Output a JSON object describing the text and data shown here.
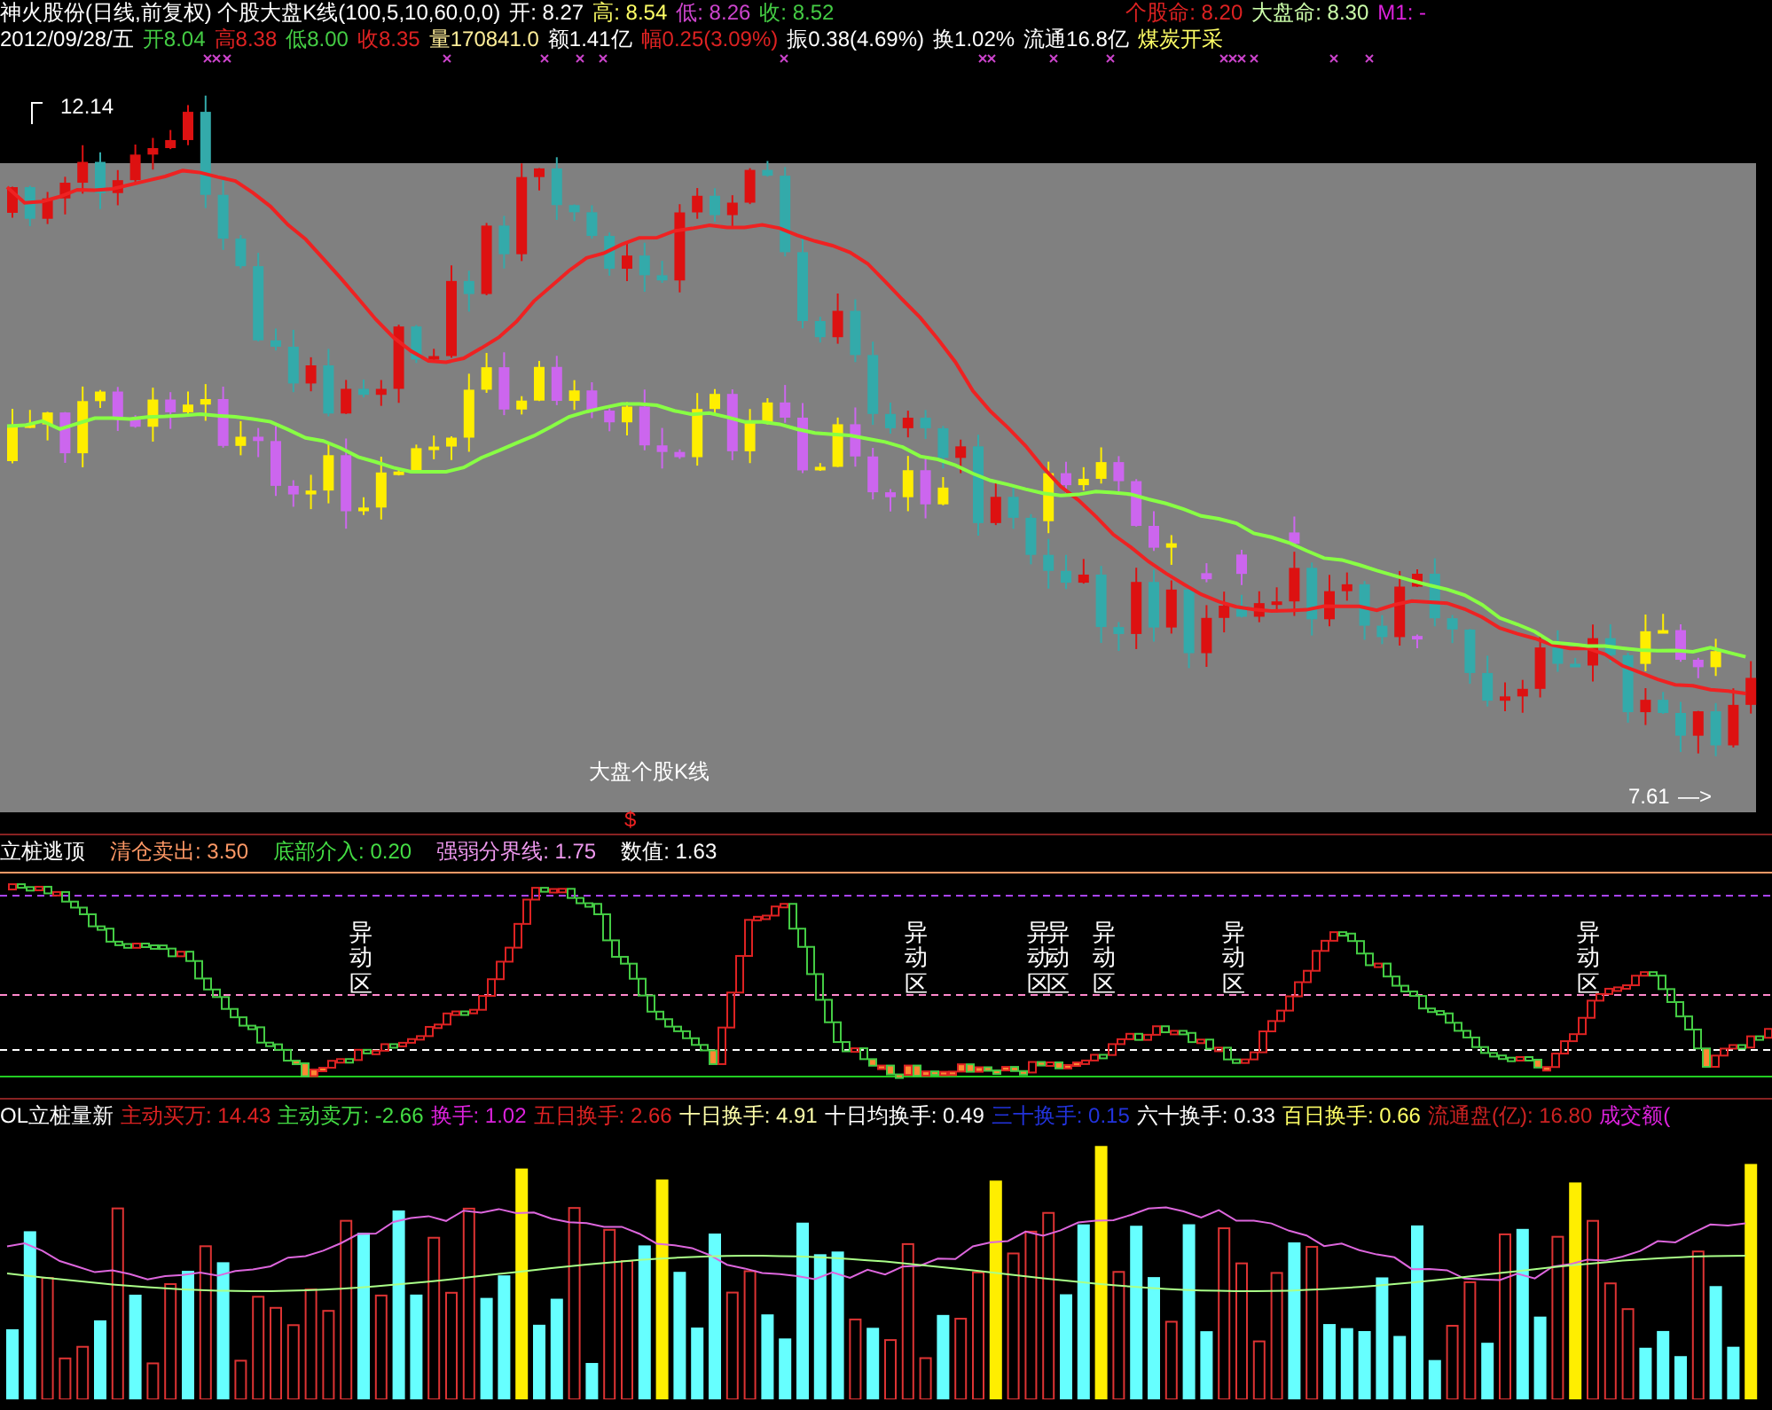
{
  "header": {
    "line1": [
      {
        "text": "神火股份(日线,前复权) 个股大盘K线(100,5,10,60,0,0)",
        "color": "#ffffff"
      },
      {
        "text": "开: 8.27",
        "color": "#ffffff"
      },
      {
        "text": "高: 8.54",
        "color": "#ffff66"
      },
      {
        "text": "低: 8.26",
        "color": "#cc44cc"
      },
      {
        "text": "收: 8.52",
        "color": "#44cc44"
      }
    ],
    "line1_right": [
      {
        "text": "个股命: 8.20",
        "color": "#dd2222"
      },
      {
        "text": "大盘命: 8.30",
        "color": "#ccffaa"
      },
      {
        "text": "M1: -",
        "color": "#dd22dd"
      }
    ],
    "line2": [
      {
        "text": "2012/09/28/五",
        "color": "#ffffff"
      },
      {
        "text": "开8.04",
        "color": "#44cc44"
      },
      {
        "text": "高8.38",
        "color": "#dd2222"
      },
      {
        "text": "低8.00",
        "color": "#44cc44"
      },
      {
        "text": "收8.35",
        "color": "#dd2222"
      },
      {
        "text": "量170841.0",
        "color": "#ffee99"
      },
      {
        "text": "额1.41亿",
        "color": "#ffffff"
      },
      {
        "text": "幅0.25(3.09%)",
        "color": "#dd2222"
      },
      {
        "text": "振0.38(4.69%)",
        "color": "#ffffff"
      },
      {
        "text": "换1.02%",
        "color": "#ffffff"
      },
      {
        "text": "流通16.8亿",
        "color": "#ffffff"
      },
      {
        "text": "煤炭开采",
        "color": "#ffff66"
      }
    ]
  },
  "main_chart": {
    "high_label": "12.14",
    "title": "大盘个股K线",
    "low_label": "7.61",
    "low_arrow": "—>",
    "marker": "$"
  },
  "indicator": {
    "legend": [
      {
        "text": "立桩逃顶",
        "color": "#ffffff"
      },
      {
        "text": "清仓卖出: 3.50",
        "color": "#ff9966"
      },
      {
        "text": "底部介入: 0.20",
        "color": "#44dd44"
      },
      {
        "text": "强弱分界线: 1.75",
        "color": "#ee99ee"
      },
      {
        "text": "数值: 1.63",
        "color": "#ffffff"
      }
    ],
    "zones": [
      "异动区",
      "异动区",
      "异动区",
      "异动区",
      "异动区",
      "异动区",
      "异动区"
    ]
  },
  "volume": {
    "legend": [
      {
        "text": "OL立桩量新",
        "color": "#ffffff"
      },
      {
        "text": "主动买万: 14.43",
        "color": "#dd2222"
      },
      {
        "text": "主动卖万: -2.66",
        "color": "#44dd44"
      },
      {
        "text": "换手: 1.02",
        "color": "#dd22dd"
      },
      {
        "text": "五日换手: 2.66",
        "color": "#dd2222"
      },
      {
        "text": "十日换手: 4.91",
        "color": "#ffffaa"
      },
      {
        "text": "十日均换手: 0.49",
        "color": "#ffffff"
      },
      {
        "text": "三十换手: 0.15",
        "color": "#2233dd"
      },
      {
        "text": "六十换手: 0.33",
        "color": "#ffffff"
      },
      {
        "text": "百日换手: 0.66",
        "color": "#ffff66"
      },
      {
        "text": "流通盘(亿): 16.80",
        "color": "#cc2222"
      },
      {
        "text": "成交额(",
        "color": "#dd22dd"
      }
    ]
  }
}
